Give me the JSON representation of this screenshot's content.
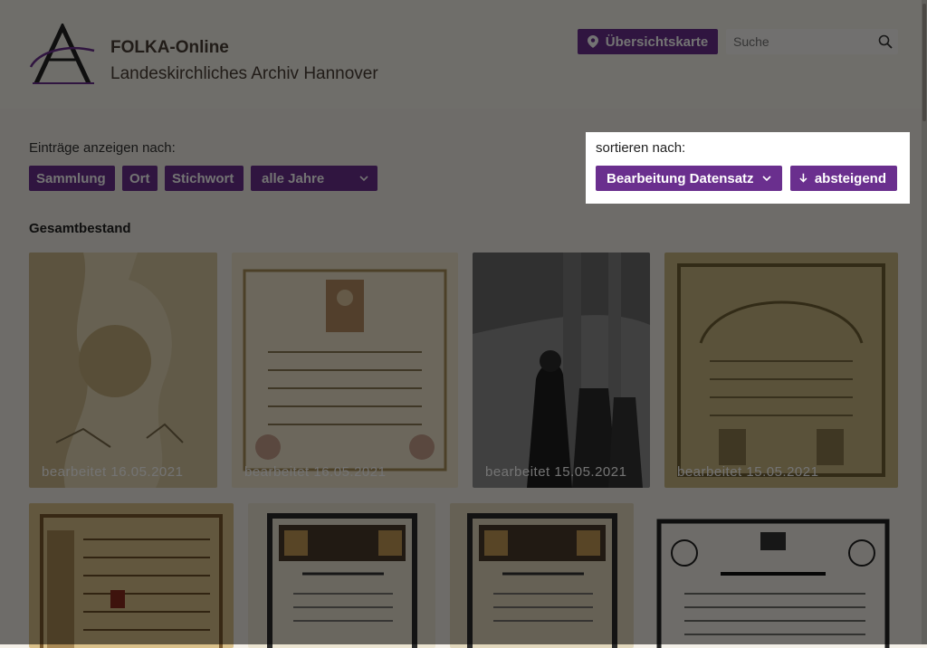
{
  "header": {
    "title": "FOLKA-Online",
    "subtitle": "Landeskirchliches Archiv Hannover",
    "map_button": "Übersichtskarte",
    "search_placeholder": "Suche"
  },
  "filters": {
    "label": "Einträge anzeigen nach:",
    "chips": [
      "Sammlung",
      "Ort",
      "Stichwort"
    ],
    "year_select": "alle Jahre"
  },
  "sort": {
    "label": "sortieren nach:",
    "field": "Bearbeitung Datensatz",
    "direction": "absteigend"
  },
  "section": {
    "title": "Gesamtbestand"
  },
  "tiles": [
    {
      "date": "bearbeitet 16.05.2021"
    },
    {
      "date": "bearbeitet 16.05.2021"
    },
    {
      "date": "bearbeitet 15.05.2021"
    },
    {
      "date": "bearbeitet 15.05.2021"
    },
    {
      "date": ""
    },
    {
      "date": ""
    },
    {
      "date": ""
    },
    {
      "date": ""
    }
  ],
  "colors": {
    "accent": "#6a2f8e",
    "overlay": "rgba(0,0,0,0.55)",
    "background": "#f4f0e8"
  },
  "icons": {
    "map_button": "map-pin-icon",
    "search": "search-icon",
    "select": "chevron-down-icon",
    "sort_direction": "arrow-down-icon"
  }
}
